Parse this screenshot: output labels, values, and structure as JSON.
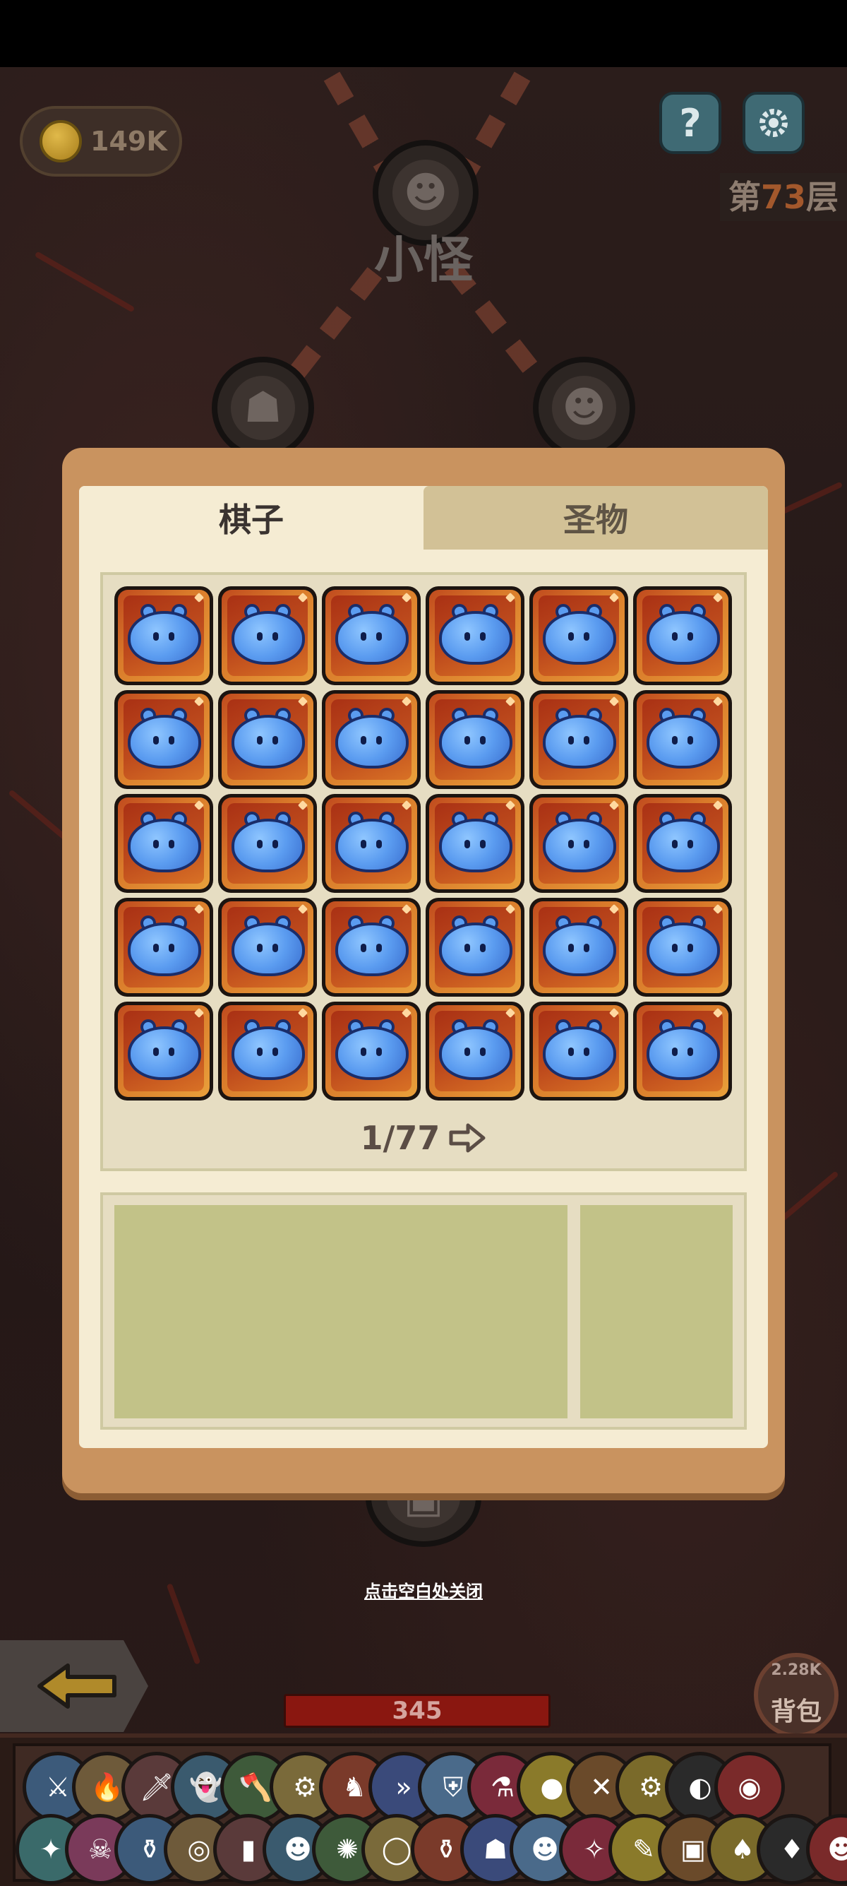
{
  "hud": {
    "coins": "149K",
    "help_label": "?",
    "floor_prefix": "第",
    "floor_number": "73",
    "floor_suffix": "层"
  },
  "map": {
    "current_node_title": "小怪"
  },
  "panel": {
    "tabs": [
      {
        "label": "棋子",
        "active": true
      },
      {
        "label": "圣物",
        "active": false
      }
    ],
    "pager": "1/77",
    "piece_count": 30
  },
  "close_hint": "点击空白处关闭",
  "bottom": {
    "hp": "345",
    "bag_count": "2.28K",
    "bag_label": "背包"
  },
  "colors": {
    "panel": "#c9935f",
    "panel_inner": "#f5ecd3",
    "tab_inactive": "#d2c196",
    "info_fill": "#c2c288",
    "hp_bar": "#8a1710"
  },
  "tray_icons_row1": [
    "sword-bolt",
    "torch",
    "dagger",
    "ghost",
    "green-axe",
    "gear-wheel",
    "fire-knight",
    "chevron-badge",
    "shield",
    "potion",
    "gold-medal",
    "crossed-swords",
    "golden-gear",
    "dark-mask",
    "red-slime"
  ],
  "tray_icons_row2": [
    "fairy",
    "skull",
    "gold-bottle",
    "purple-ring",
    "blue-boot",
    "red-face",
    "fire-bird",
    "bone-ring",
    "blue-urn",
    "dwarf",
    "tribal-mask",
    "mage",
    "feather",
    "treasure-chest",
    "bird-warrior",
    "fire-lizard",
    "red-demon"
  ]
}
